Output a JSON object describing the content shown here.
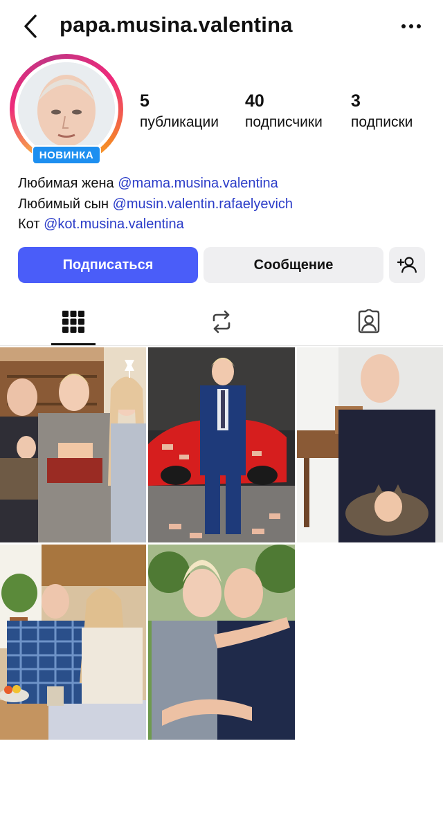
{
  "header": {
    "username": "papa.musina.valentina",
    "back_icon": "chevron-left-icon",
    "more_icon": "more-horizontal-icon"
  },
  "profile": {
    "badge": "НОВИНКА",
    "stats": [
      {
        "value": "5",
        "label": "публикации"
      },
      {
        "value": "40",
        "label": "подписчики"
      },
      {
        "value": "3",
        "label": "подписки"
      }
    ]
  },
  "bio": {
    "lines": [
      {
        "text": "Любимая жена ",
        "link": "@mama.musina.valentina"
      },
      {
        "text": "Любимый сын ",
        "link": "@musin.valentin.rafaelyevich"
      },
      {
        "text": "Кот ",
        "link": "@kot.musina.valentina"
      }
    ]
  },
  "actions": {
    "follow_label": "Подписаться",
    "message_label": "Сообщение",
    "add_friend_icon": "person-add-icon"
  },
  "tabs": [
    {
      "name": "grid",
      "icon": "grid-icon",
      "active": true
    },
    {
      "name": "reels",
      "icon": "repost-icon",
      "active": false
    },
    {
      "name": "tagged",
      "icon": "tagged-person-icon",
      "active": false
    }
  ],
  "posts": [
    {
      "pinned": true
    },
    {
      "pinned": false
    },
    {
      "pinned": false
    },
    {
      "pinned": false
    },
    {
      "pinned": false
    }
  ],
  "colors": {
    "follow_button": "#4a5df9",
    "secondary_button": "#efeff1",
    "link": "#2b3cc8",
    "badge": "#1d8ff0"
  }
}
